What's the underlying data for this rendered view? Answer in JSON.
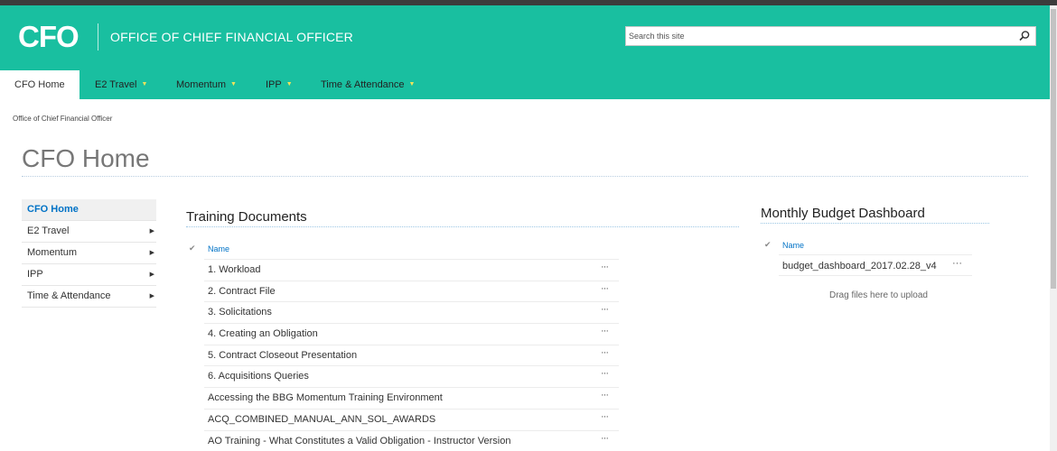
{
  "header": {
    "logo": "CFO",
    "site_title": "OFFICE OF CHIEF FINANCIAL OFFICER",
    "search_placeholder": "Search this site"
  },
  "nav": {
    "items": [
      {
        "label": "CFO Home",
        "active": true
      },
      {
        "label": "E2 Travel"
      },
      {
        "label": "Momentum"
      },
      {
        "label": "IPP"
      },
      {
        "label": "Time & Attendance"
      }
    ],
    "arrow": "▼"
  },
  "breadcrumb": "Office of Chief Financial Officer",
  "page_title": "CFO Home",
  "left_nav": {
    "items": [
      {
        "label": "CFO Home"
      },
      {
        "label": "E2 Travel"
      },
      {
        "label": "Momentum"
      },
      {
        "label": "IPP"
      },
      {
        "label": "Time & Attendance"
      }
    ],
    "arrow": "▶"
  },
  "training_documents": {
    "title": "Training Documents",
    "column_name": "Name",
    "check_glyph": "✔",
    "ellipsis": "···",
    "rows": [
      "1. Workload",
      "2. Contract File",
      "3. Solicitations",
      "4. Creating an Obligation",
      "5. Contract Closeout Presentation",
      "6. Acquisitions Queries",
      "Accessing the BBG Momentum Training Environment",
      "ACQ_COMBINED_MANUAL_ANN_SOL_AWARDS",
      "AO Training - What Constitutes a Valid Obligation - Instructor Version"
    ]
  },
  "budget_dashboard": {
    "title": "Monthly Budget Dashboard",
    "column_name": "Name",
    "file": "budget_dashboard_2017.02.28_v4",
    "drag_hint": "Drag files here to upload"
  },
  "colors": {
    "brand": "#19bfa0",
    "link": "#0072c6"
  }
}
